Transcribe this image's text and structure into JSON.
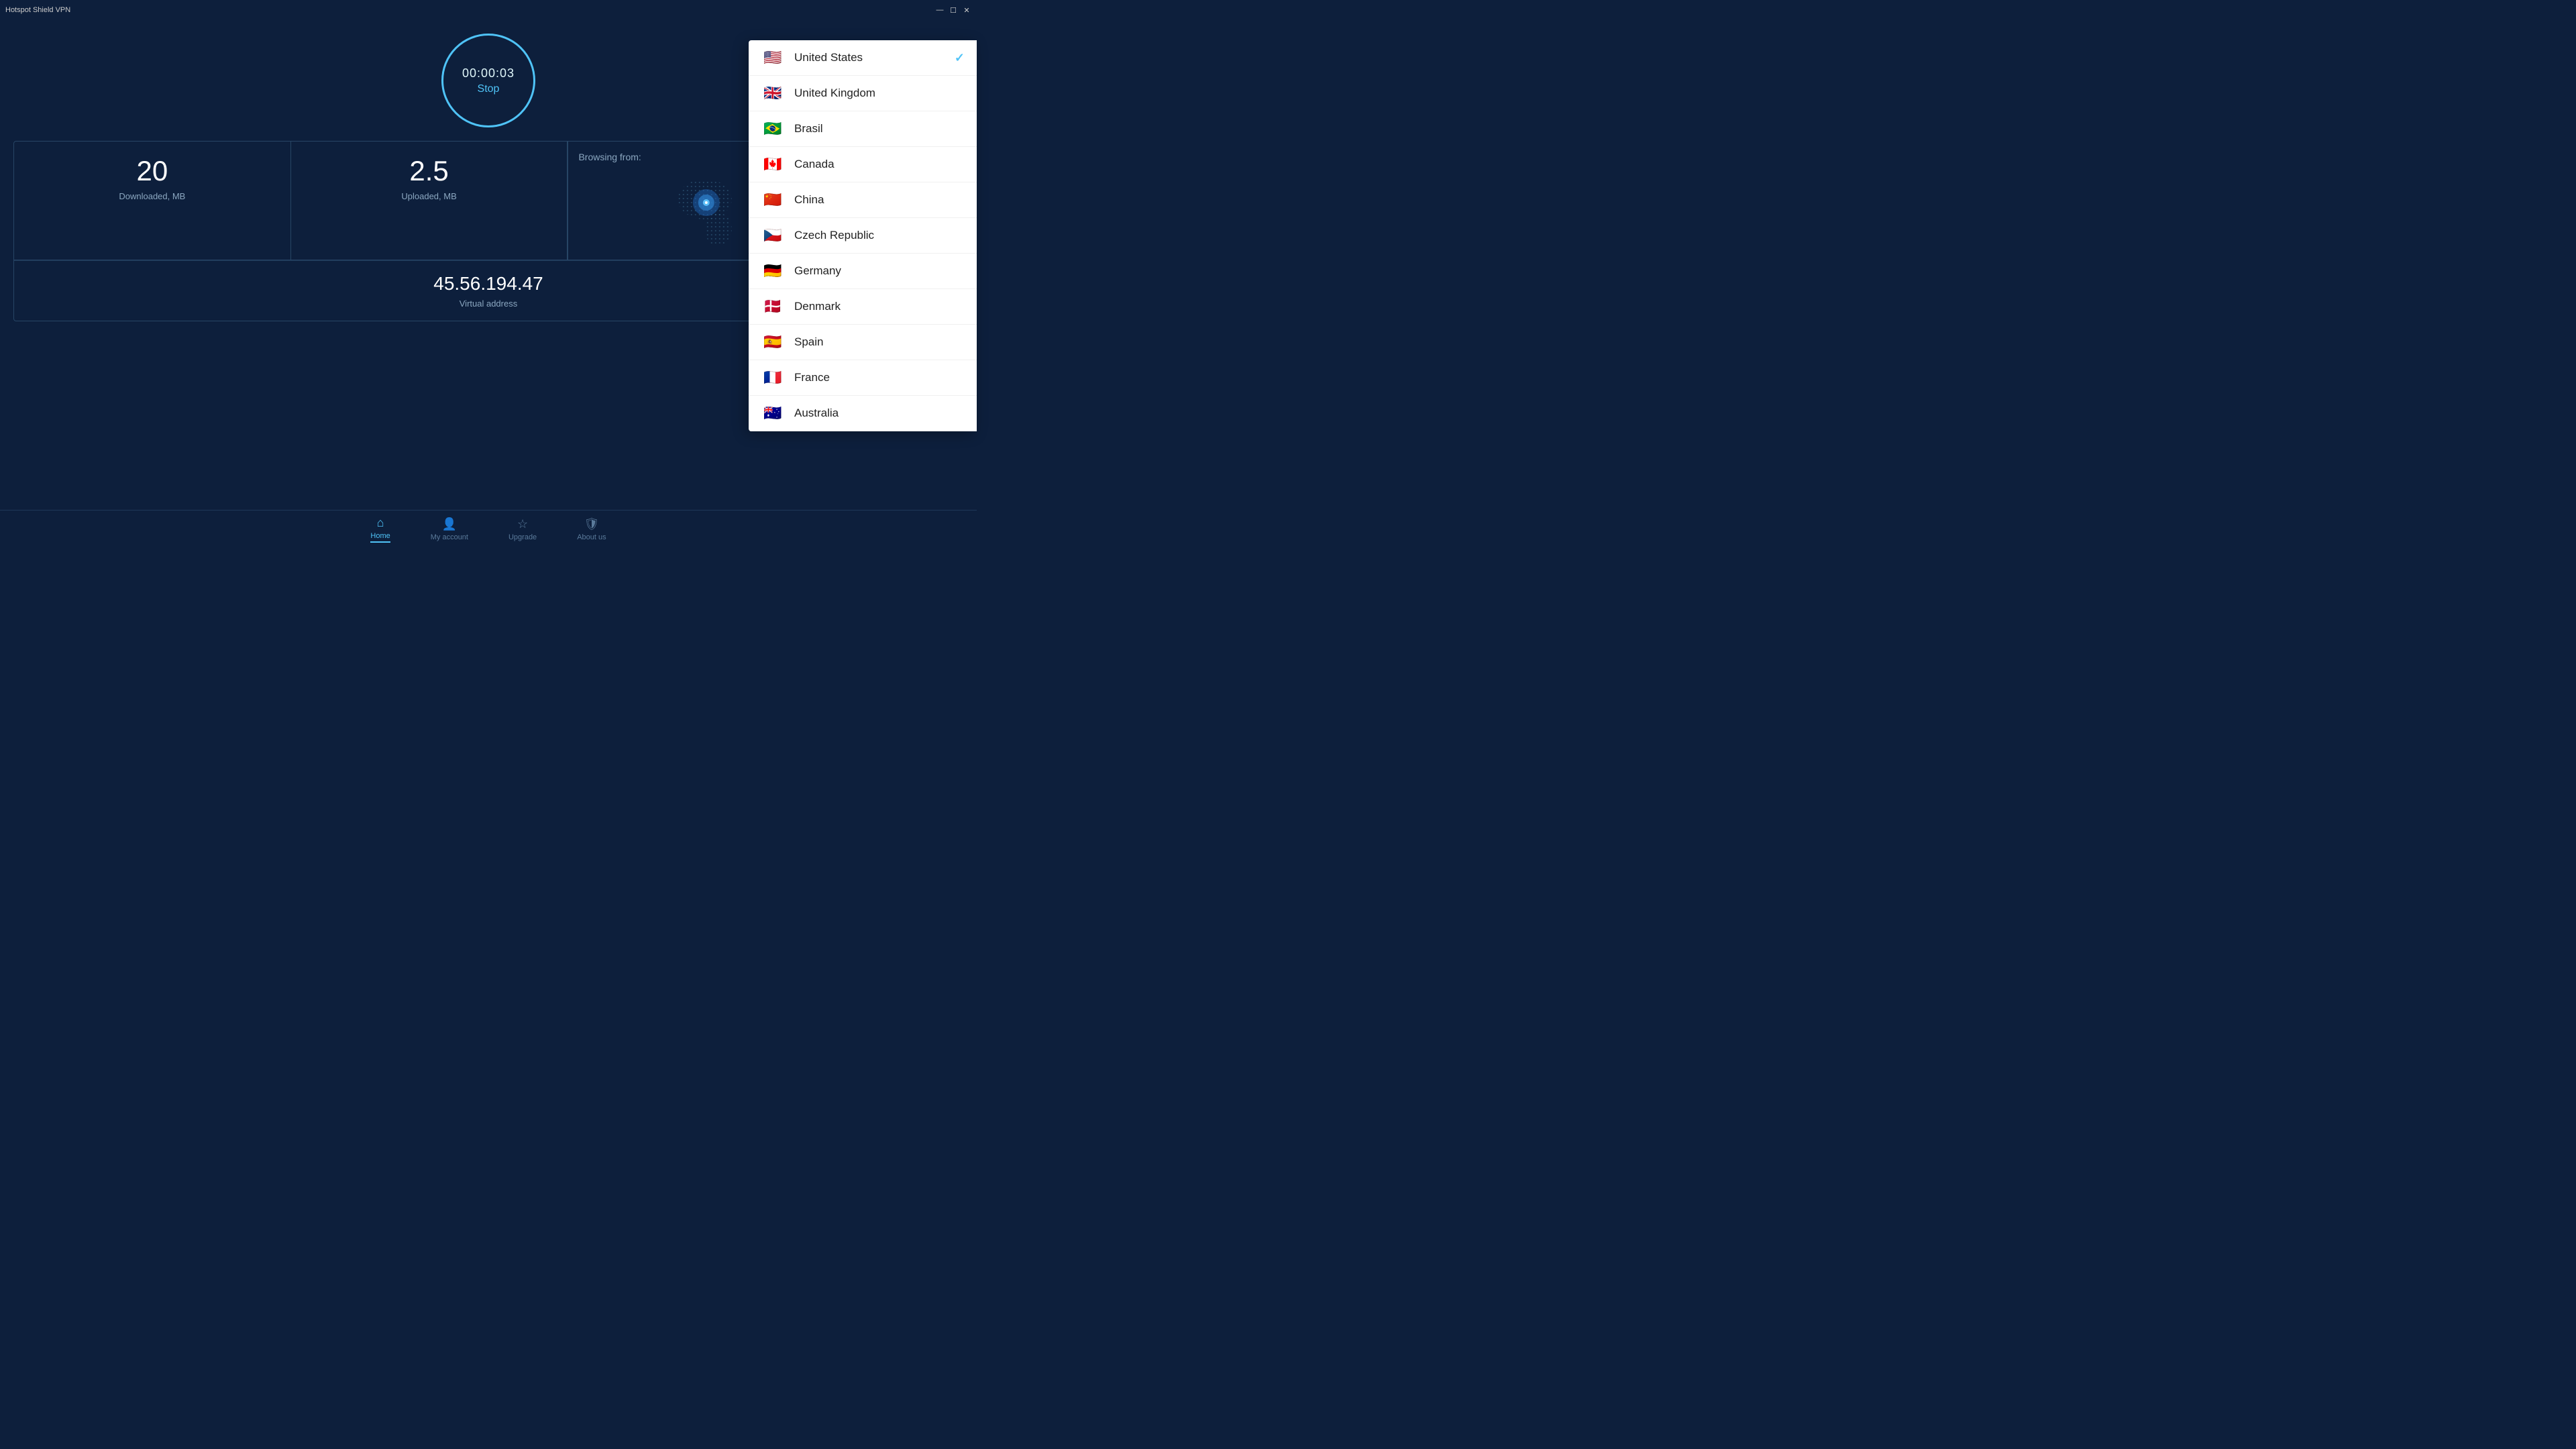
{
  "app": {
    "title": "Hotspot Shield VPN",
    "window_controls": {
      "minimize": "—",
      "maximize": "☐",
      "close": "✕"
    }
  },
  "timer": {
    "time": "00:00:03",
    "stop_label": "Stop"
  },
  "stats": {
    "downloaded_value": "20",
    "downloaded_label": "Downloaded, MB",
    "uploaded_value": "2.5",
    "uploaded_label": "Uploaded, MB",
    "browsing_from_label": "Browsing from:",
    "ip_address": "45.56.194.47",
    "ip_label": "Virtual address"
  },
  "countries": [
    {
      "id": "us",
      "name": "United States",
      "flag": "🇺🇸",
      "selected": true
    },
    {
      "id": "gb",
      "name": "United Kingdom",
      "flag": "🇬🇧",
      "selected": false
    },
    {
      "id": "br",
      "name": "Brasil",
      "flag": "🇧🇷",
      "selected": false
    },
    {
      "id": "ca",
      "name": "Canada",
      "flag": "🇨🇦",
      "selected": false
    },
    {
      "id": "cn",
      "name": "China",
      "flag": "🇨🇳",
      "selected": false
    },
    {
      "id": "cz",
      "name": "Czech Republic",
      "flag": "🇨🇿",
      "selected": false
    },
    {
      "id": "de",
      "name": "Germany",
      "flag": "🇩🇪",
      "selected": false
    },
    {
      "id": "dk",
      "name": "Denmark",
      "flag": "🇩🇰",
      "selected": false
    },
    {
      "id": "es",
      "name": "Spain",
      "flag": "🇪🇸",
      "selected": false
    },
    {
      "id": "fr",
      "name": "France",
      "flag": "🇫🇷",
      "selected": false
    },
    {
      "id": "au",
      "name": "Australia",
      "flag": "🇦🇺",
      "selected": false
    }
  ],
  "nav": {
    "home_label": "Home",
    "my_account_label": "My account",
    "upgrade_label": "Upgrade",
    "about_us_label": "About us"
  },
  "colors": {
    "active_tab": "#4fc3f7",
    "background": "#0d1f3c",
    "accent": "#4fc3f7"
  }
}
